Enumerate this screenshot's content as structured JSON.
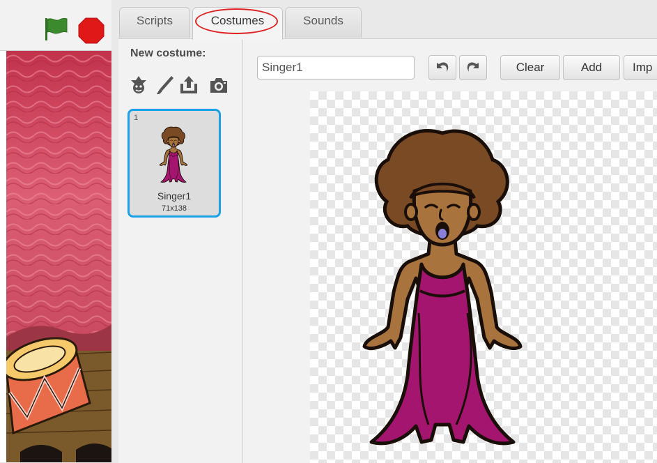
{
  "tabs": {
    "scripts": "Scripts",
    "costumes": "Costumes",
    "sounds": "Sounds",
    "active": "Costumes"
  },
  "costume_panel": {
    "new_costume_label": "New costume:",
    "tools": [
      "choose-costume-from-library-icon",
      "paint-brush-icon",
      "upload-costume-icon",
      "camera-icon"
    ],
    "costumes": [
      {
        "number": "1",
        "name": "Singer1",
        "size": "71x138",
        "selected": true
      }
    ]
  },
  "editor": {
    "costume_name": "Singer1",
    "buttons": {
      "clear": "Clear",
      "add": "Add",
      "import": "Imp"
    },
    "icons": [
      "undo-icon",
      "redo-icon"
    ]
  },
  "colors": {
    "selection_blue": "#1aa0e8",
    "annotation_red": "#dd2222",
    "flag_green": "#3c8a2e",
    "stop_red": "#e01818",
    "dress_purple": "#a3156f",
    "skin_brown": "#a8733c",
    "hair_brown": "#7a4a24",
    "curtain_pink": "#d74a60"
  }
}
